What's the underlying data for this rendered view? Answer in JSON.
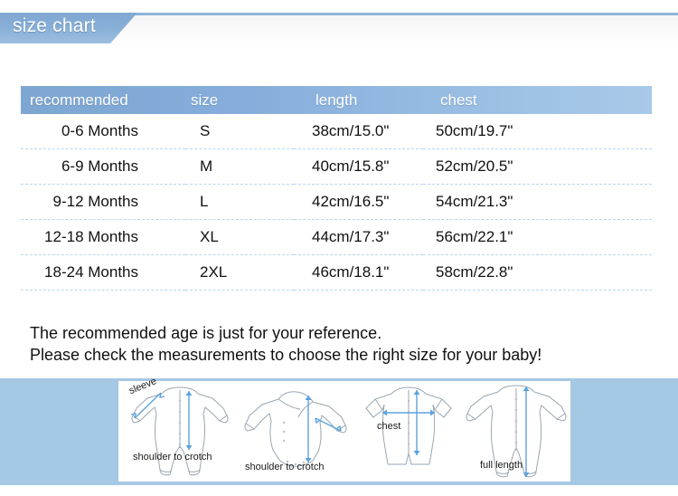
{
  "banner": {
    "title": "size chart"
  },
  "table": {
    "columns": [
      "recommended",
      "size",
      "length",
      "chest"
    ],
    "rows": [
      [
        "0-6  Months",
        "S",
        "38cm/15.0\"",
        "50cm/19.7\""
      ],
      [
        "6-9  Months",
        "M",
        "40cm/15.8\"",
        "52cm/20.5\""
      ],
      [
        "9-12 Months",
        "L",
        "42cm/16.5\"",
        "54cm/21.3\""
      ],
      [
        "12-18 Months",
        "XL",
        "44cm/17.3\"",
        "56cm/22.1\""
      ],
      [
        "18-24 Months",
        "2XL",
        "46cm/18.1\"",
        "58cm/22.8\""
      ]
    ]
  },
  "note": {
    "line1": "The recommended age is just for your reference.",
    "line2": "Please check the measurements to choose the right size for your baby!"
  },
  "illustration": {
    "figures": [
      {
        "garment": "long-sleeve-footed-romper",
        "labels": [
          "sleeve",
          "shoulder to crotch"
        ]
      },
      {
        "garment": "long-sleeve-bodysuit",
        "labels": [
          "shoulder to crotch"
        ]
      },
      {
        "garment": "short-sleeve-romper",
        "labels": [
          "chest"
        ]
      },
      {
        "garment": "long-sleeve-footed-romper",
        "labels": [
          "full length"
        ]
      }
    ],
    "label_sleeve": "sleeve",
    "label_shoulder_to_crotch_1": "shoulder to crotch",
    "label_shoulder_to_crotch_2": "shoulder to crotch",
    "label_chest": "chest",
    "label_full_length": "full length"
  },
  "colors": {
    "banner_blue": "#87aed6",
    "header_blue_left": "#7da6d2",
    "header_blue_right": "#a9c9e8",
    "band_blue": "#a5c8e5",
    "row_divider": "#b9d6ee",
    "arrow_blue": "#5ca3dd",
    "garment_outline": "#9aa6b0"
  }
}
